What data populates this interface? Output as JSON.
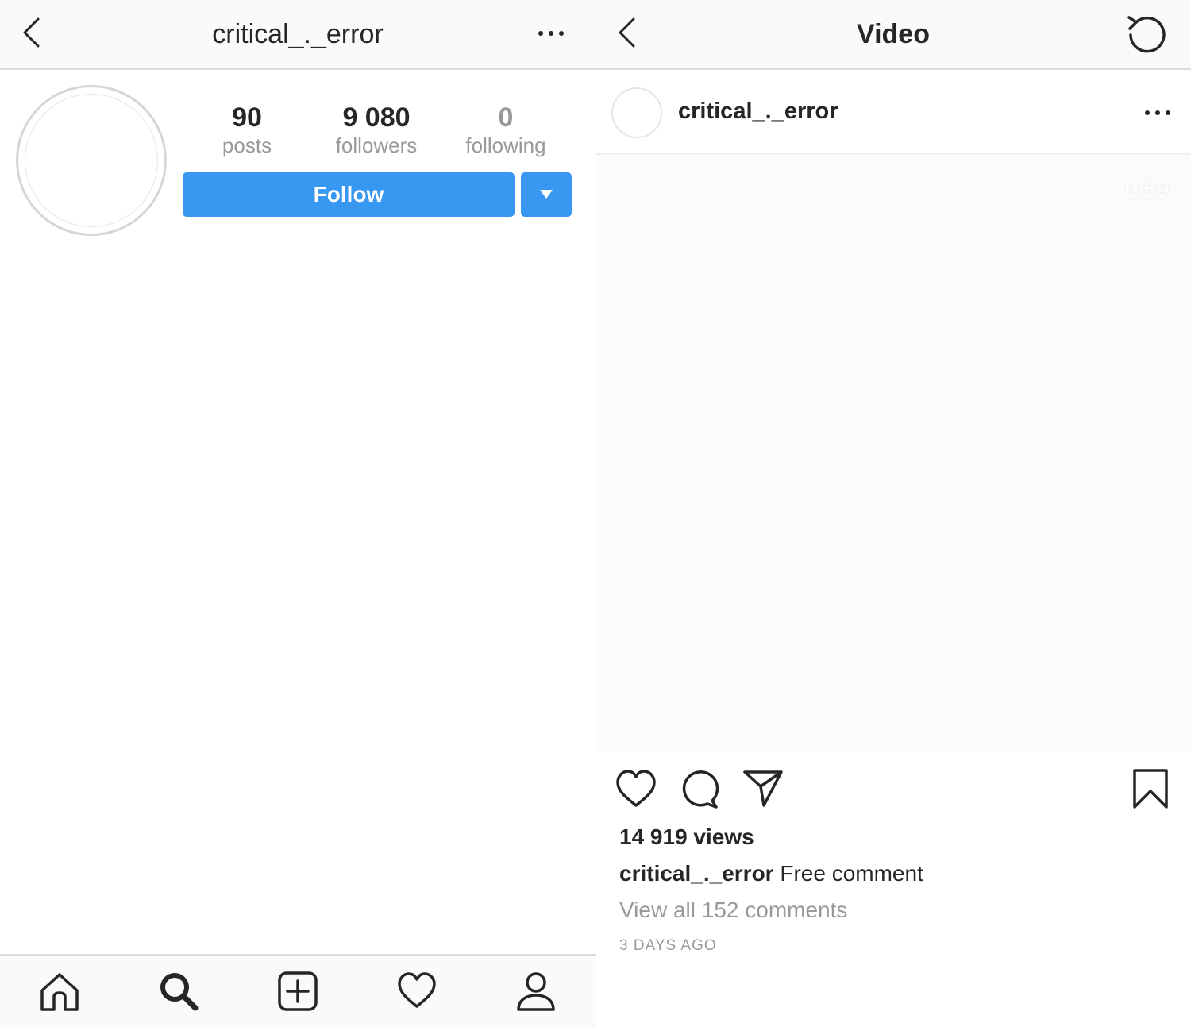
{
  "profile_screen": {
    "header": {
      "title": "critical_._error"
    },
    "stats": {
      "posts": {
        "value": "90",
        "label": "posts"
      },
      "followers": {
        "value": "9 080",
        "label": "followers"
      },
      "following": {
        "value": "0",
        "label": "following"
      }
    },
    "follow_button": "Follow",
    "tabs": [
      "home",
      "search",
      "new-post",
      "activity",
      "profile"
    ]
  },
  "video_screen": {
    "header": {
      "title": "Video"
    },
    "post": {
      "username": "critical_._error",
      "duration": "0:59",
      "views": "14 919 views",
      "caption_user": "critical_._error",
      "caption_text": " Free comment",
      "view_comments": "View all 152 comments",
      "timestamp": "3 DAYS AGO"
    }
  },
  "colors": {
    "accent": "#3897f0",
    "text": "#262626",
    "muted": "#999999",
    "bar_bg": "#fafafa",
    "divider": "#dbdbdb"
  },
  "icons": [
    "back-icon",
    "more-icon",
    "refresh-icon",
    "caret-down-icon",
    "home-icon",
    "search-icon",
    "plus-square-icon",
    "heart-icon",
    "user-icon",
    "comment-icon",
    "share-icon",
    "bookmark-icon"
  ]
}
